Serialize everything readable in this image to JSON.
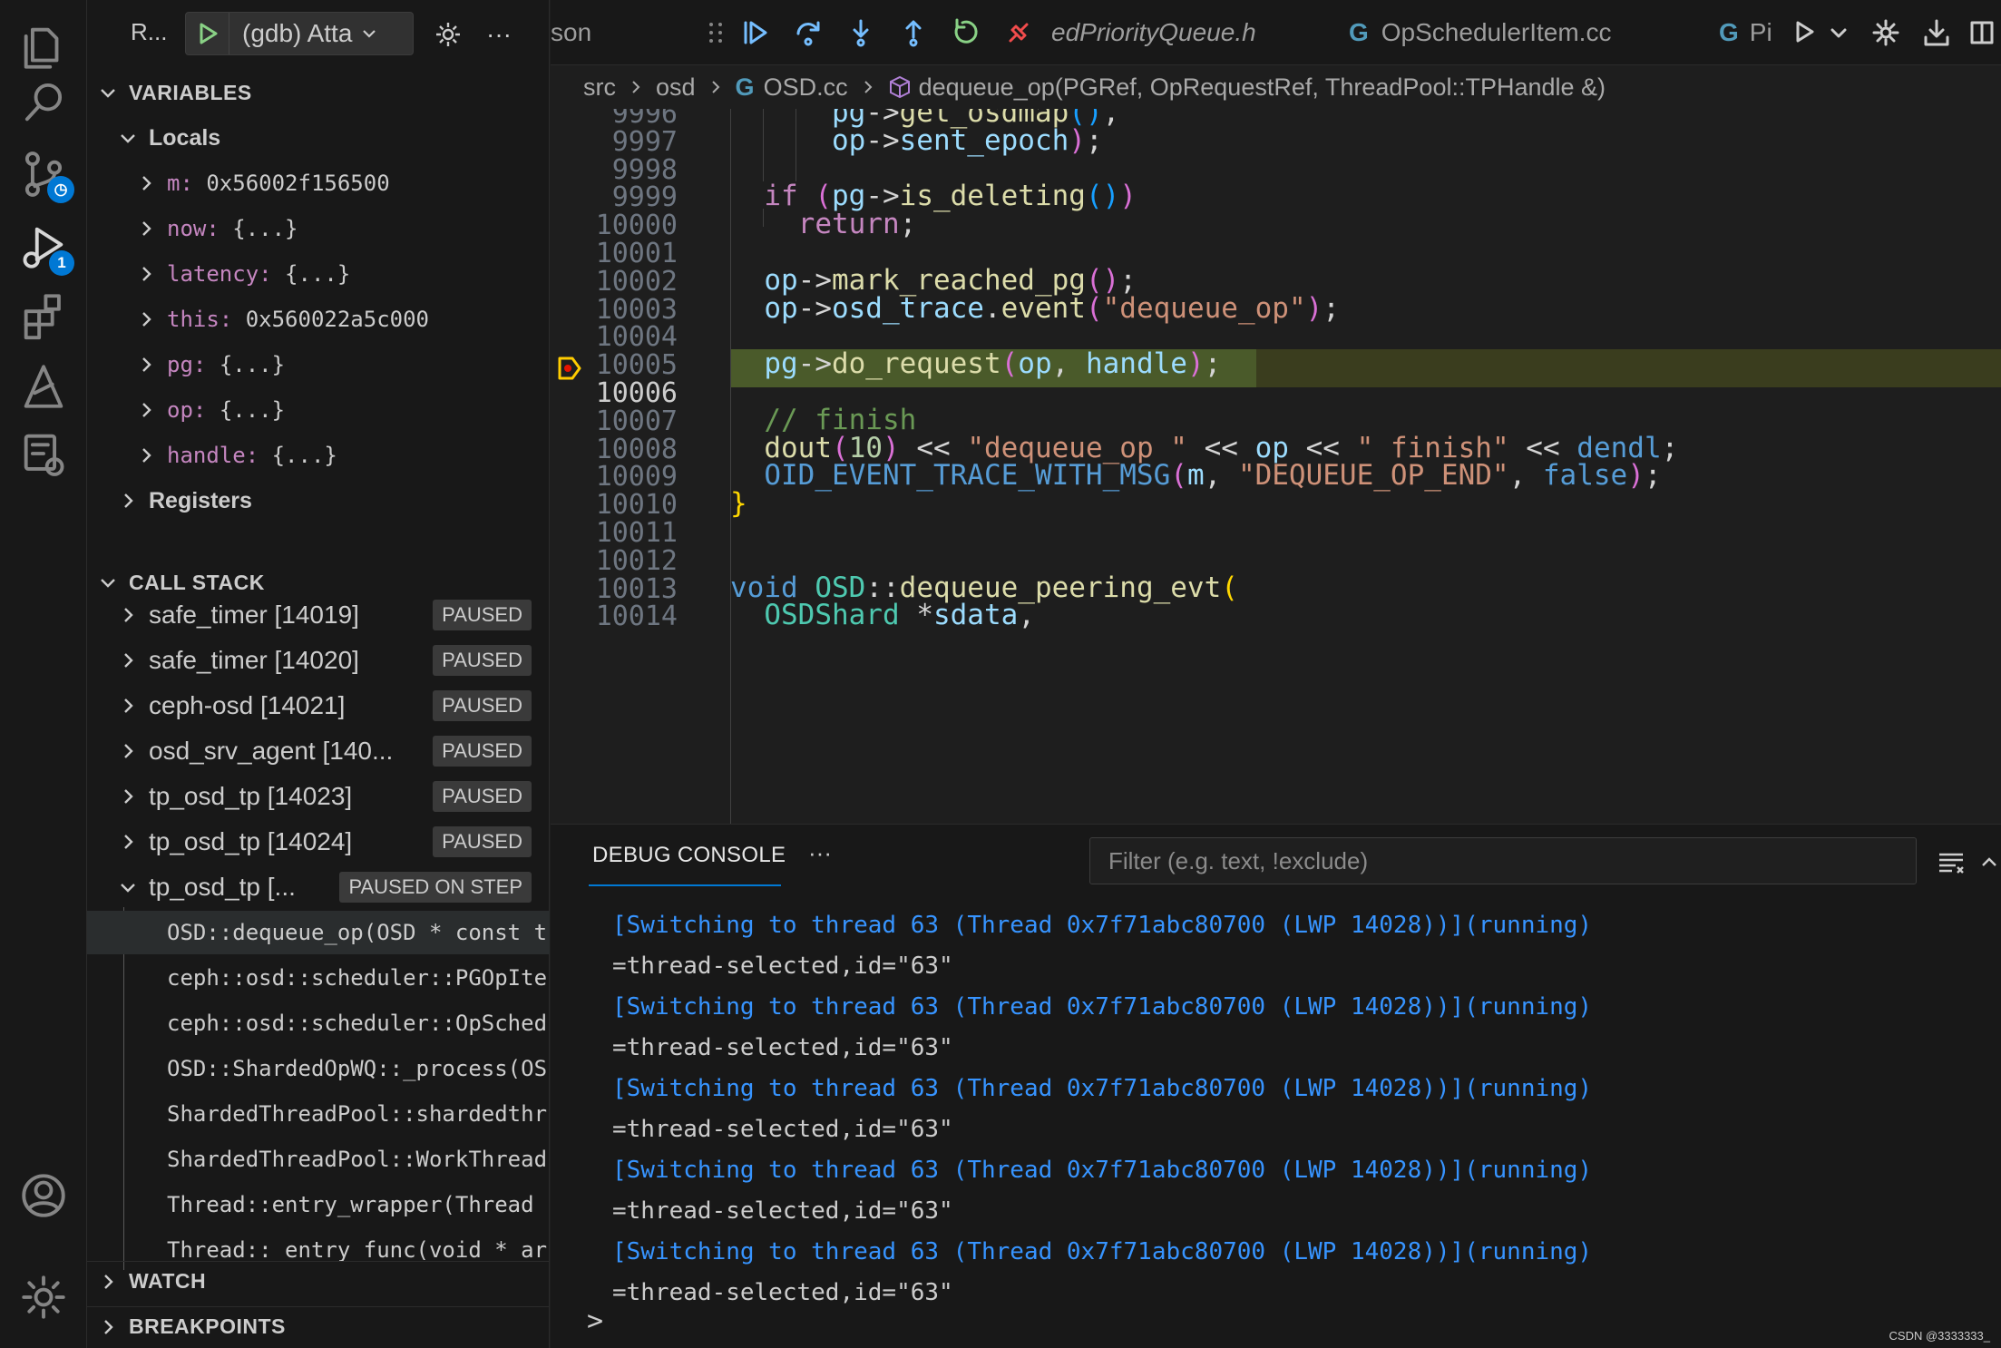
{
  "activity_bar": {
    "items": [
      {
        "icon": "explorer-icon"
      },
      {
        "icon": "search-icon"
      },
      {
        "icon": "source-control-icon"
      },
      {
        "icon": "run-debug-icon",
        "badge": "1"
      },
      {
        "icon": "extensions-icon"
      },
      {
        "icon": "remote-icon"
      },
      {
        "icon": "remote-explorer-icon"
      }
    ],
    "bottom": [
      {
        "icon": "account-icon"
      },
      {
        "icon": "manage-gear-icon"
      }
    ]
  },
  "debug_header": {
    "title": "R...",
    "config": "(gdb) Atta"
  },
  "sections": {
    "variables": "VARIABLES",
    "locals": "Locals",
    "registers": "Registers",
    "call_stack": "CALL STACK",
    "watch": "WATCH",
    "breakpoints": "BREAKPOINTS"
  },
  "locals": [
    {
      "name": "m:",
      "value": "0x56002f156500"
    },
    {
      "name": "now:",
      "value": "{...}"
    },
    {
      "name": "latency:",
      "value": "{...}"
    },
    {
      "name": "this:",
      "value": "0x560022a5c000"
    },
    {
      "name": "pg:",
      "value": "{...}"
    },
    {
      "name": "op:",
      "value": "{...}"
    },
    {
      "name": "handle:",
      "value": "{...}"
    }
  ],
  "threads": [
    {
      "name": "safe_timer [14019]",
      "status": "PAUSED"
    },
    {
      "name": "safe_timer [14020]",
      "status": "PAUSED"
    },
    {
      "name": "ceph-osd [14021]",
      "status": "PAUSED"
    },
    {
      "name": "osd_srv_agent [140...",
      "status": "PAUSED"
    },
    {
      "name": "tp_osd_tp [14023]",
      "status": "PAUSED"
    },
    {
      "name": "tp_osd_tp [14024]",
      "status": "PAUSED"
    },
    {
      "name": "tp_osd_tp [...",
      "status": "PAUSED ON STEP"
    }
  ],
  "frames": [
    "OSD::dequeue_op(OSD * const t",
    "ceph::osd::scheduler::PGOpIte",
    "ceph::osd::scheduler::OpSched",
    "OSD::ShardedOpWQ::_process(OS",
    "ShardedThreadPool::shardedthr",
    "ShardedThreadPool::WorkThread",
    "Thread::entry_wrapper(Thread",
    "Thread:: entry func(void * ar"
  ],
  "tabs": {
    "partial_left": "son",
    "tab1": "edPriorityQueue.h",
    "tab2": "OpSchedulerItem.cc",
    "tab3": "Pi"
  },
  "breadcrumb": {
    "src": "src",
    "osd": "osd",
    "file": "OSD.cc",
    "symbol": "dequeue_op(PGRef, OpRequestRef, ThreadPool::TPHandle &)"
  },
  "code": {
    "line_numbers": [
      "9996",
      "9997",
      "9998",
      "9999",
      "10000",
      "10001",
      "10002",
      "10003",
      "10004",
      "10005",
      "10006",
      "10007",
      "10008",
      "10009",
      "10010",
      "10011",
      "10012",
      "10013",
      "10014"
    ],
    "current_line": "10006",
    "paused_line": "10005"
  },
  "panel": {
    "tab": "DEBUG CONSOLE",
    "more": "···",
    "filter_placeholder": "Filter (e.g. text, !exclude)",
    "lines": [
      "[Switching to thread 63 (Thread 0x7f71abc80700 (LWP 14028))](running)",
      "=thread-selected,id=\"63\"",
      "[Switching to thread 63 (Thread 0x7f71abc80700 (LWP 14028))](running)",
      "=thread-selected,id=\"63\"",
      "[Switching to thread 63 (Thread 0x7f71abc80700 (LWP 14028))](running)",
      "=thread-selected,id=\"63\"",
      "[Switching to thread 63 (Thread 0x7f71abc80700 (LWP 14028))](running)",
      "=thread-selected,id=\"63\"",
      "[Switching to thread 63 (Thread 0x7f71abc80700 (LWP 14028))](running)",
      "=thread-selected,id=\"63\""
    ],
    "prompt": ">"
  },
  "watermark": "CSDN @3333333_",
  "colors": {
    "accent": "#0078d4",
    "paused_arrow": "#ffcc00",
    "console_blue": "#3794ff"
  }
}
